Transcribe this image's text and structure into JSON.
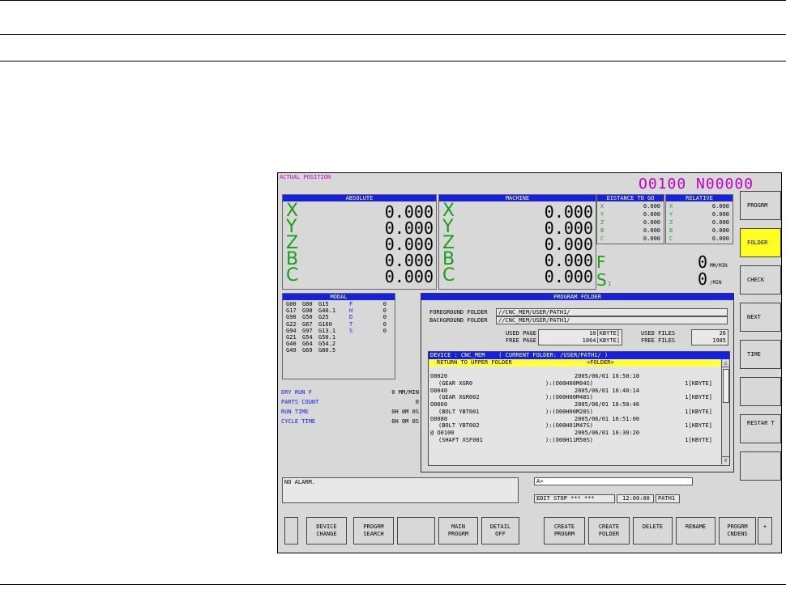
{
  "screen": {
    "title": "ACTUAL POSITION",
    "program_number": "O0100 N00000"
  },
  "absolute": {
    "header": "ABSOLUTE",
    "axes": [
      {
        "axis": "X",
        "value": "0.000"
      },
      {
        "axis": "Y",
        "value": "0.000"
      },
      {
        "axis": "Z",
        "value": "0.000"
      },
      {
        "axis": "B",
        "value": "0.000"
      },
      {
        "axis": "C",
        "value": "0.000"
      }
    ]
  },
  "machine": {
    "header": "MACHINE",
    "axes": [
      {
        "axis": "X",
        "value": "0.000"
      },
      {
        "axis": "Y",
        "value": "0.000"
      },
      {
        "axis": "Z",
        "value": "0.000"
      },
      {
        "axis": "B",
        "value": "0.000"
      },
      {
        "axis": "C",
        "value": "0.000"
      }
    ]
  },
  "distance_to_go": {
    "header": "DISTANCE TO GO",
    "axes": [
      {
        "axis": "X",
        "value": "0.000"
      },
      {
        "axis": "Y",
        "value": "0.000"
      },
      {
        "axis": "Z",
        "value": "0.000"
      },
      {
        "axis": "B",
        "value": "0.000"
      },
      {
        "axis": "C",
        "value": "0.000"
      }
    ]
  },
  "relative": {
    "header": "RELATIVE",
    "axes": [
      {
        "axis": "X",
        "value": "0.000"
      },
      {
        "axis": "Y",
        "value": "0.000"
      },
      {
        "axis": "Z",
        "value": "0.000"
      },
      {
        "axis": "B",
        "value": "0.000"
      },
      {
        "axis": "C",
        "value": "0.000"
      }
    ]
  },
  "feed": {
    "label": "F",
    "value": "0",
    "unit": "MM/MIN"
  },
  "spindle": {
    "label": "S",
    "sub": "1",
    "value": "0",
    "unit": "/MIN"
  },
  "modal": {
    "header": "MODAL",
    "rows": [
      [
        "G00",
        "G80",
        "G15",
        "F",
        "0"
      ],
      [
        "G17",
        "G98",
        "G40.1",
        "H",
        "0"
      ],
      [
        "G90",
        "G50",
        "G25",
        "D",
        "0"
      ],
      [
        "G22",
        "G67",
        "G160",
        "T",
        "0"
      ],
      [
        "G94",
        "G97",
        "G13.1",
        "S",
        "0"
      ],
      [
        "G21",
        "G54",
        "G50.1",
        "",
        ""
      ],
      [
        "G40",
        "G64",
        "G54.2",
        "",
        ""
      ],
      [
        "G49",
        "G69",
        "G80.5",
        "",
        ""
      ]
    ]
  },
  "status_info": [
    {
      "label": "DRY RUN F",
      "value": "0 MM/MIN"
    },
    {
      "label": "PARTS COUNT",
      "value": "0"
    },
    {
      "label": "RUN TIME",
      "value": "0H 0M 0S"
    },
    {
      "label": "CYCLE TIME",
      "value": "0H 0M 0S"
    }
  ],
  "program_folder": {
    "header": "PROGRAM FOLDER",
    "foreground_label": "FOREGROUND FOLDER",
    "foreground_value": "//CNC_MEM/USER/PATH1/",
    "background_label": "BACKGROUND FOLDER",
    "background_value": "//CNC_MEM/USER/PATH1/",
    "used_page_label": "USED PAGE",
    "used_page_value": "10[KBYTE]",
    "free_page_label": "FREE PAGE",
    "free_page_value": "1064[KBYTE]",
    "used_files_label": "USED FILES",
    "used_files_value": "26",
    "free_files_label": "FREE FILES",
    "free_files_value": "1985",
    "device_line": "DEVICE : CNC_MEM    ( CURRENT FOLDER: /USER/PATH1/ )",
    "return_label": "RETURN TO UPPER FOLDER",
    "return_tag": "<FOLDER>",
    "files": [
      {
        "name": "O0020",
        "date": "2005/06/01 16:50:10",
        "comment": "(GEAR XGR0",
        "code": "):(O00H00M04S)",
        "size": "1[KBYTE]"
      },
      {
        "name": "O0040",
        "date": "2005/06/01 16:40:14",
        "comment": "(GEAR XGR002",
        "code": "):(O00H00M48S)",
        "size": "1[KBYTE]"
      },
      {
        "name": "O0060",
        "date": "2005/06/01 16:50:46",
        "comment": "(BOLT YBT001",
        "code": "):(O00H00M20S)",
        "size": "1[KBYTE]"
      },
      {
        "name": "O0080",
        "date": "2005/06/01 16:51:00",
        "comment": "(BOLT YBT002",
        "code": "):(O00H01M47S)",
        "size": "1[KBYTE]"
      },
      {
        "name": "@ O0100",
        "date": "2005/06/01 16:30:20",
        "comment": "(SHAFT XSF001",
        "code": "):(O00H11M50S)",
        "size": "1[KBYTE]"
      }
    ]
  },
  "alarm_text": "NO ALARM.",
  "input_prompt": "A>",
  "mode_status": "EDIT STOP *** ***",
  "clock": "12:00:00",
  "path": "PATH1",
  "side_keys": [
    {
      "label": "PROGRM",
      "active": false
    },
    {
      "label": "FOLDER",
      "active": true
    },
    {
      "label": "CHECK",
      "active": false
    },
    {
      "label": "NEXT",
      "active": false
    },
    {
      "label": "TIME",
      "active": false
    },
    {
      "label": "",
      "active": false
    },
    {
      "label": "RESTAR T",
      "active": false
    },
    {
      "label": "",
      "active": false
    }
  ],
  "soft_keys": [
    {
      "line1": "",
      "line2": "",
      "green": false
    },
    {
      "line1": "DEVICE",
      "line2": "CHANGE",
      "green": true
    },
    {
      "line1": "PROGRM",
      "line2": "SEARCH",
      "green": true
    },
    {
      "line1": "",
      "line2": "",
      "green": false
    },
    {
      "line1": "MAIN",
      "line2": "PROGRM",
      "green": false
    },
    {
      "line1": "DETAIL",
      "line2": "OFF",
      "green": false
    },
    {
      "line1": "CREATE",
      "line2": "PROGRM",
      "green": false
    },
    {
      "line1": "CREATE",
      "line2": "FOLDER",
      "green": false
    },
    {
      "line1": "DELETE",
      "line2": "",
      "green": true
    },
    {
      "line1": "RENAME",
      "line2": "",
      "green": false
    },
    {
      "line1": "PROGRM",
      "line2": "CNDENS",
      "green": false
    },
    {
      "line1": "+",
      "line2": "",
      "green": false
    }
  ],
  "colors": {
    "header_blue": "#1520e0",
    "axis_green": "#18a018",
    "magenta": "#c000c0",
    "active_key": "#ffff20",
    "return_bar": "#ffff40"
  }
}
